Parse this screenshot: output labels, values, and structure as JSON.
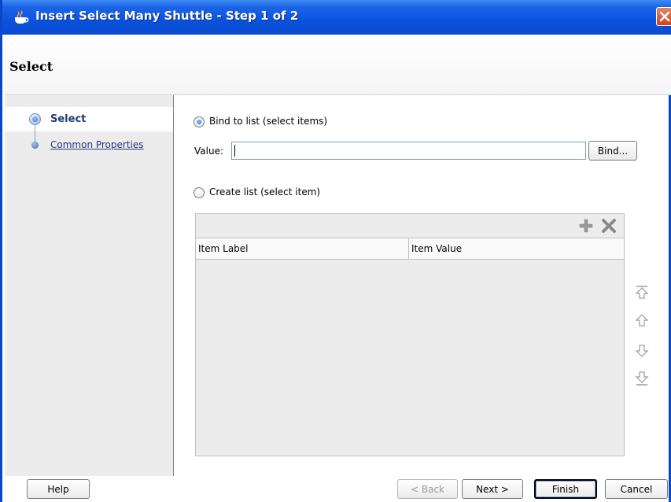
{
  "window": {
    "title": "Insert Select Many Shuttle - Step 1 of 2",
    "close_icon": "close-icon",
    "title_bar_color": "#0a52dc"
  },
  "header": {
    "title": "Select"
  },
  "nav": {
    "items": [
      {
        "label": "Select",
        "selected": true,
        "icon": "step-current-icon"
      },
      {
        "label": "Common Properties",
        "selected": false,
        "icon": "step-dot-icon"
      }
    ]
  },
  "content": {
    "bind_radio_label": "Bind to list (select items)",
    "bind_radio_checked": true,
    "value_label": "Value:",
    "value_input": "",
    "bind_button": "Bind...",
    "create_radio_label": "Create list (select item)",
    "create_radio_checked": false,
    "table": {
      "add_icon": "add-icon",
      "delete_icon": "delete-icon",
      "columns": [
        "Item Label",
        "Item Value"
      ],
      "rows": []
    },
    "side_icons": [
      "move-top-icon",
      "move-up-icon",
      "move-down-icon",
      "move-bottom-icon"
    ]
  },
  "footer": {
    "help": "Help",
    "back": "< Back",
    "next": "Next >",
    "finish": "Finish",
    "cancel": "Cancel"
  }
}
